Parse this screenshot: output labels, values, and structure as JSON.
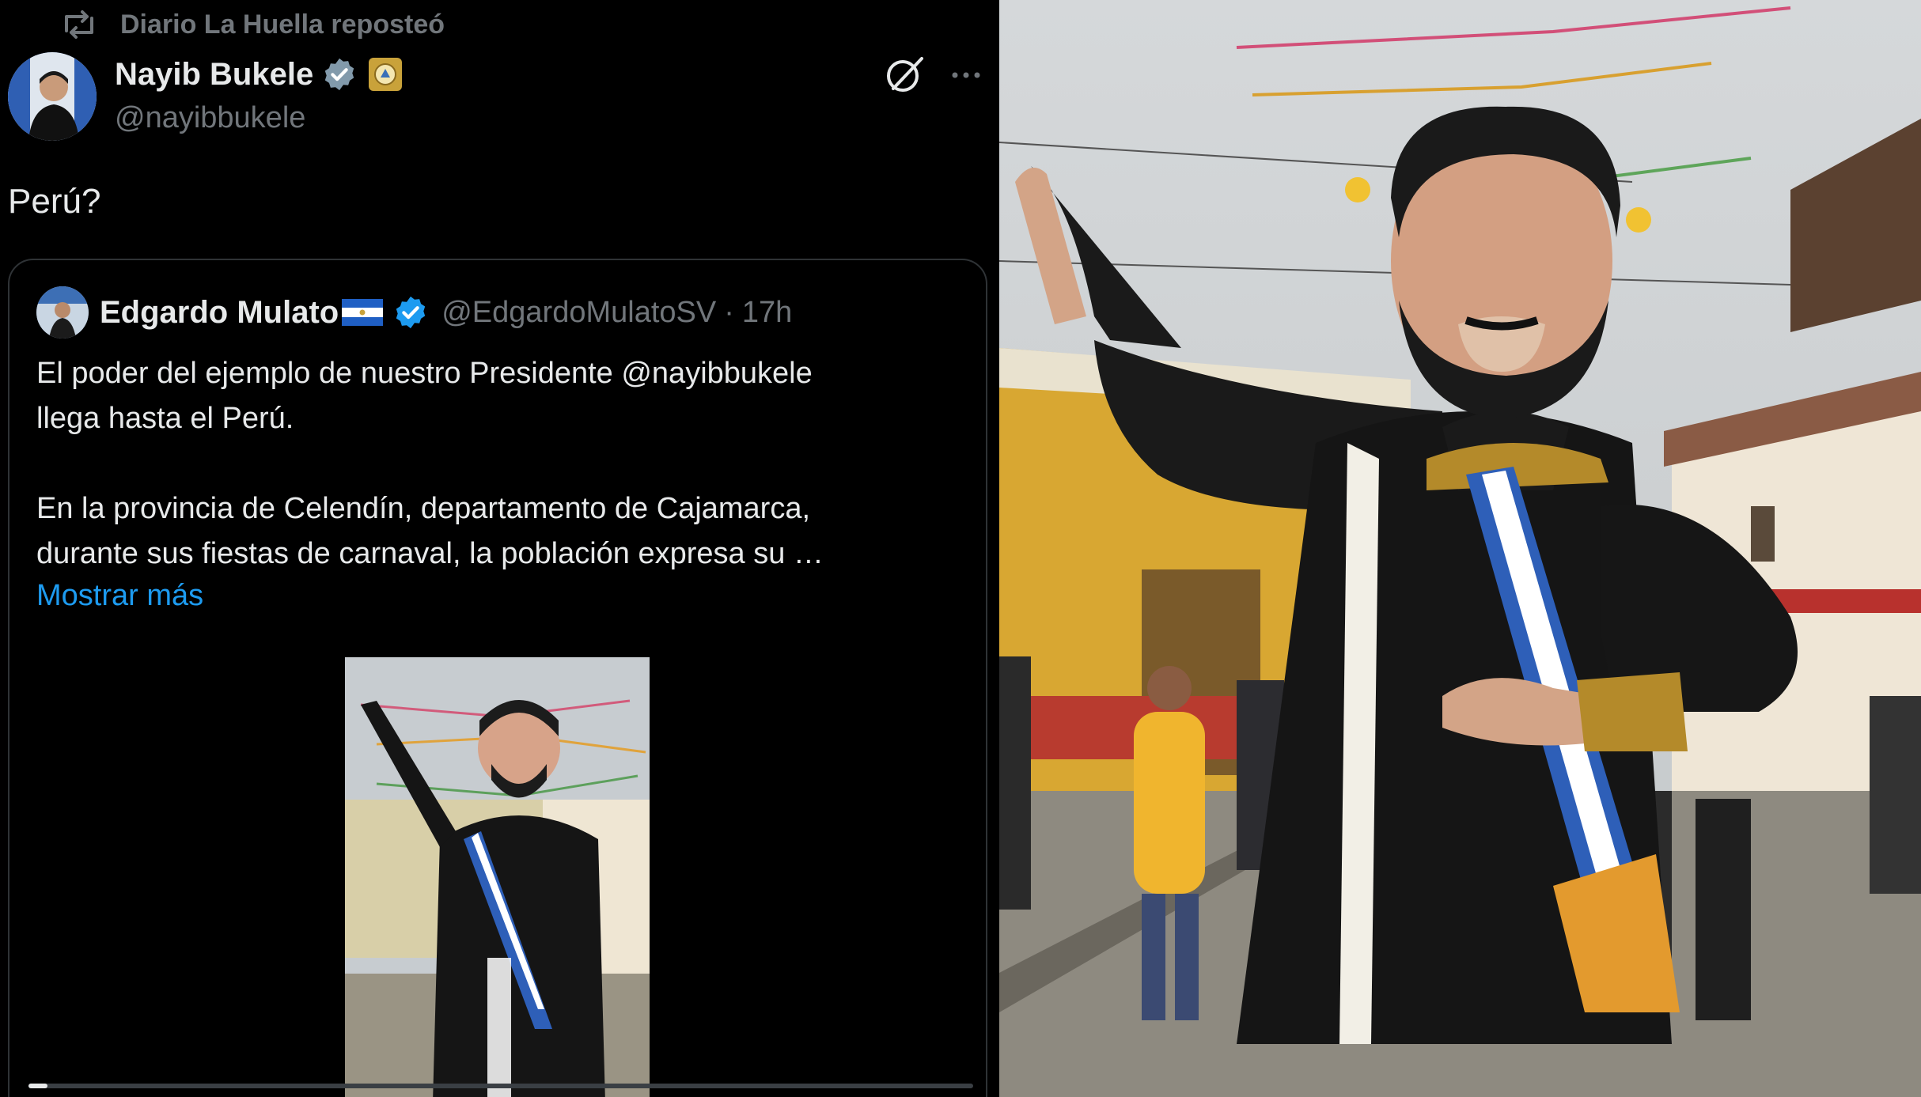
{
  "repost": {
    "text": "Diario La Huella reposteó",
    "icon": "repost-icon"
  },
  "post": {
    "author_name": "Nayib Bukele",
    "author_handle": "@nayibbukele",
    "text": "Perú?"
  },
  "quote": {
    "author_name": "Edgardo Mulato",
    "author_handle": "@EdgardoMulatoSV",
    "separator": "·",
    "time": "17h",
    "text_line1": "El poder del ejemplo de nuestro Presidente @nayibbukele",
    "text_line2": "llega hasta el Perú.",
    "text_line3": "En la provincia de Celendín, departamento de Cajamarca,",
    "text_line4": "durante sus fiestas de carnaval, la población expresa su …",
    "show_more": "Mostrar más",
    "video_progress": 0.02
  },
  "colors": {
    "background": "#000000",
    "text": "#e7e9ea",
    "muted": "#71767b",
    "link": "#1d9bf0",
    "verified": "#1d9bf0",
    "border": "#2f3336"
  },
  "icons": [
    "repost-icon",
    "verified-icon",
    "government-badge-icon",
    "grok-icon",
    "more-icon",
    "flag-el-salvador-icon"
  ]
}
